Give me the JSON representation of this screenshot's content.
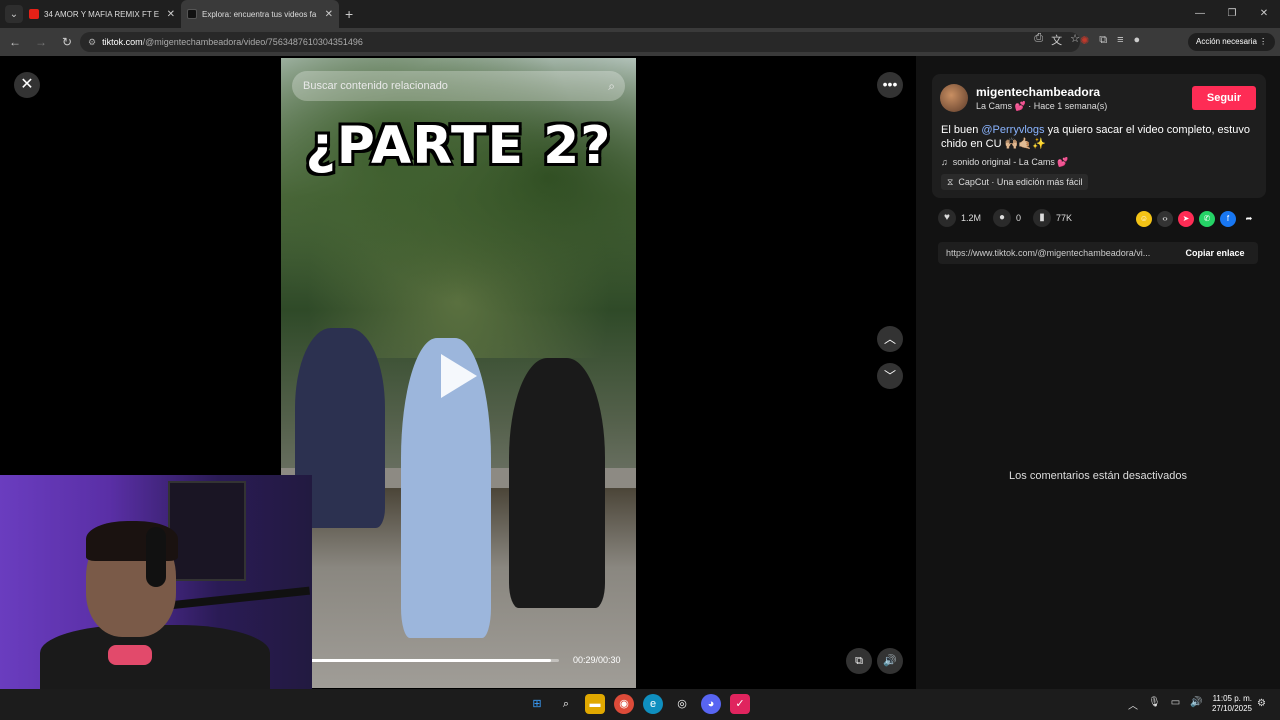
{
  "browser": {
    "tabs": [
      {
        "title": "34 AMOR Y MAFIA REMIX FT E",
        "favicon": "youtube-icon",
        "active": false
      },
      {
        "title": "Explora: encuentra tus videos fa",
        "favicon": "tiktok-icon",
        "active": true
      }
    ],
    "new_tab": "+",
    "address_host": "tiktok.com",
    "address_path": "/@migentechambeadora/video/7563487610304351496",
    "action_button": "Acción necesaria"
  },
  "video": {
    "search_placeholder": "Buscar contenido relacionado",
    "overlay_title": "¿PARTE 2?",
    "time": "00:29/00:30",
    "progress": 0.967
  },
  "post": {
    "username": "migentechambeadora",
    "meta": "La Cams 💕 · Hace 1 semana(s)",
    "follow_label": "Seguir",
    "desc_prefix": "El buen ",
    "mention": "@Perryvlogs",
    "desc_suffix": " ya quiero sacar el video completo, estuvo chido en CU 🙌🏼🤙🏼✨",
    "music": "sonido original - La Cams 💕",
    "capcut": "CapCut · Una edición más fácil",
    "likes": "1.2M",
    "comments": "0",
    "saves": "77K",
    "link": "https://www.tiktok.com/@migentechambeadora/vi...",
    "copy_label": "Copiar enlace",
    "comments_off": "Los comentarios están desactivados"
  },
  "taskbar": {
    "time": "11:05 p. m.",
    "date": "27/10/2025"
  },
  "colors": {
    "follow": "#fe2c55",
    "mention": "#8ab4ff"
  }
}
